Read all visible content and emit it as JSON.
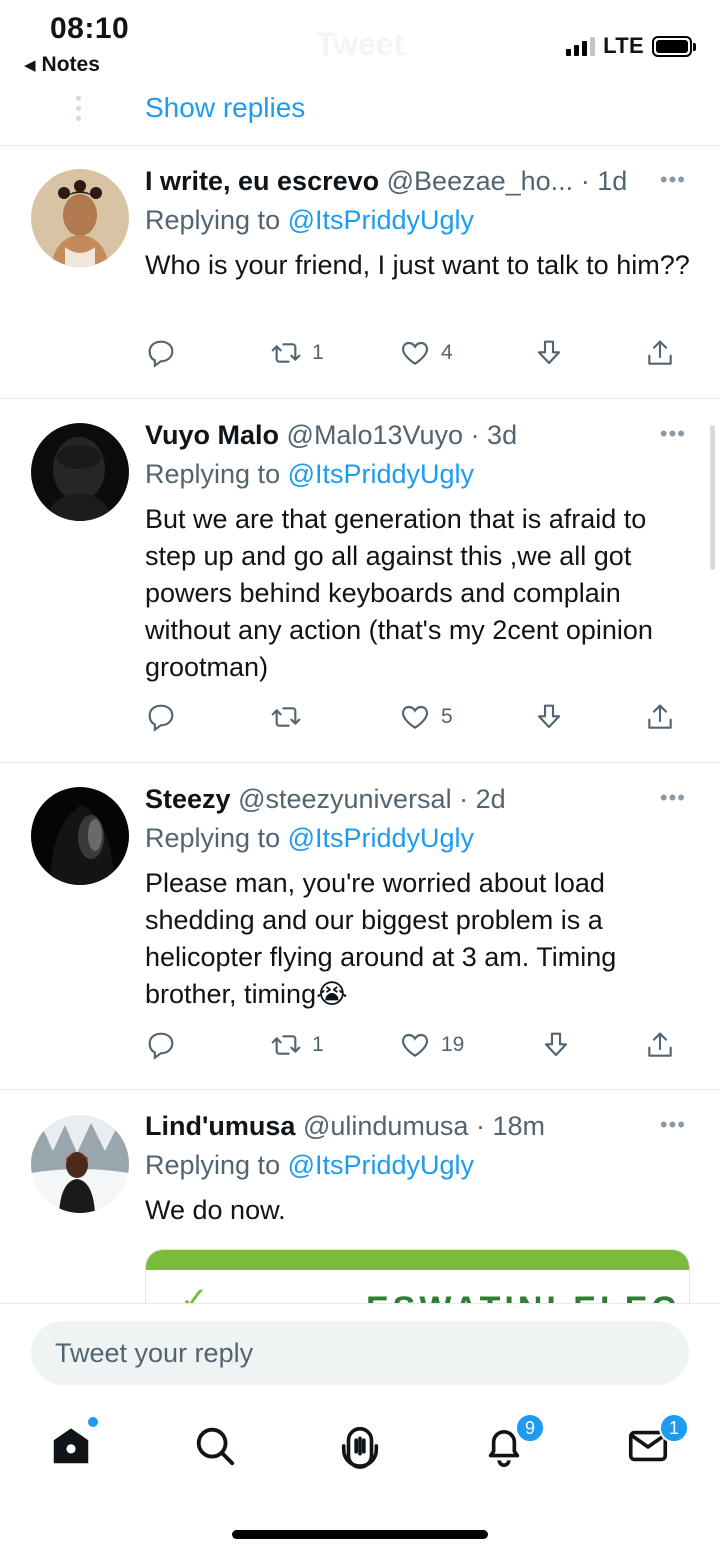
{
  "status_bar": {
    "time": "08:10",
    "back_app": "Notes",
    "network": "LTE",
    "ghost_title": "Tweet"
  },
  "thread": {
    "show_replies": "Show replies"
  },
  "tweets": [
    {
      "name": "I write, eu escrevo",
      "handle": "@Beezae_ho...",
      "time": "· 1d",
      "replying_prefix": "Replying to ",
      "replying_to": "@ItsPriddyUgly",
      "text": "Who is your friend, I just want to talk to him??",
      "retweets": "1",
      "likes": "4"
    },
    {
      "name": "Vuyo Malo",
      "handle": "@Malo13Vuyo",
      "time": "· 3d",
      "replying_prefix": "Replying to ",
      "replying_to": "@ItsPriddyUgly",
      "text": "But we are that generation that is afraid to step up and  go all against this ,we all got powers behind keyboards and complain without any action (that's my 2cent opinion grootman)",
      "retweets": "",
      "likes": "5"
    },
    {
      "name": "Steezy",
      "handle": "@steezyuniversal",
      "time": "· 2d",
      "replying_prefix": "Replying to ",
      "replying_to": "@ItsPriddyUgly",
      "text": "Please man, you're worried about load shedding and our biggest problem is a helicopter flying around at 3 am. Timing brother, timing😭",
      "retweets": "1",
      "likes": "19"
    },
    {
      "name": "Lind'umusa",
      "handle": "@ulindumusa",
      "time": "· 18m",
      "replying_prefix": "Replying to ",
      "replying_to": "@ItsPriddyUgly",
      "text": "We do now.",
      "media_text": "ESWATINI ELEC"
    }
  ],
  "reply_bar": {
    "placeholder": "Tweet your reply"
  },
  "tab_bar": {
    "notifications_badge": "9",
    "messages_badge": "1"
  },
  "colors": {
    "accent": "#1d9bf0",
    "text_secondary": "#536471",
    "divider": "#e7e9eb"
  }
}
